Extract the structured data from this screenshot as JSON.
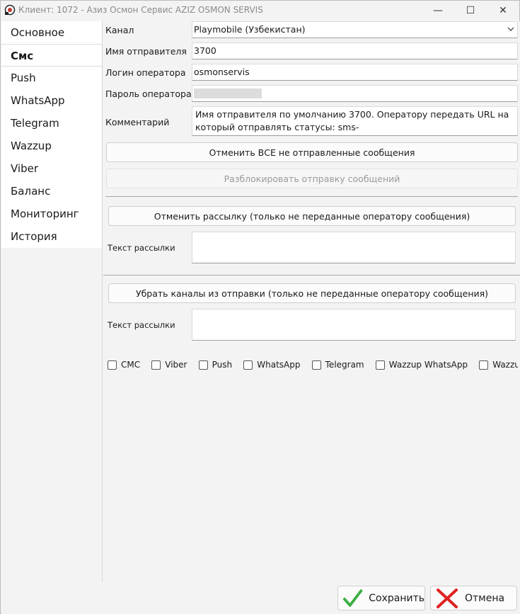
{
  "window": {
    "title": "Клиент: 1072 - Азиз Осмон Сервис AZIZ OSMON SERVIS",
    "controls": {
      "minimize": "—",
      "maximize": "☐",
      "close": "✕"
    }
  },
  "sidebar": {
    "items": [
      {
        "label": "Основное"
      },
      {
        "label": "Смс",
        "active": true
      },
      {
        "label": "Push"
      },
      {
        "label": "WhatsApp"
      },
      {
        "label": "Telegram"
      },
      {
        "label": "Wazzup"
      },
      {
        "label": "Viber"
      },
      {
        "label": "Баланс"
      },
      {
        "label": "Мониторинг"
      },
      {
        "label": "История"
      }
    ]
  },
  "form": {
    "channel_label": "Канал",
    "channel_value": "Playmobile (Узбекистан)",
    "sender_label": "Имя отправителя",
    "sender_value": "3700",
    "login_label": "Логин оператора",
    "login_value": "osmonservis",
    "password_label": "Пароль оператора",
    "comment_label": "Комментарий",
    "comment_value": "Имя отправителя по умолчанию 3700. Оператору передать URL на который отправлять статусы: sms-workflow.com/smsctrl/GetPlayMobile.php",
    "cancel_all_button": "Отменить ВСЕ не отправленные сообщения",
    "unblock_button": "Разблокировать отправку сообщений",
    "cancel_mailing_button": "Отменить рассылку (только не переданные оператору сообщения)",
    "mailing_text_label_1": "Текст рассылки",
    "remove_channels_button": "Убрать каналы из отправки (только не переданные оператору сообщения)",
    "mailing_text_label_2": "Текст рассылки",
    "channel_checks": [
      "СМС",
      "Viber",
      "Push",
      "WhatsApp",
      "Telegram",
      "Wazzup WhatsApp",
      "Wazzup Telegram"
    ]
  },
  "footer": {
    "save_label": "Сохранить",
    "cancel_label": "Отмена"
  },
  "colors": {
    "save_check": "#3cb043",
    "cancel_x": "#e02020"
  }
}
